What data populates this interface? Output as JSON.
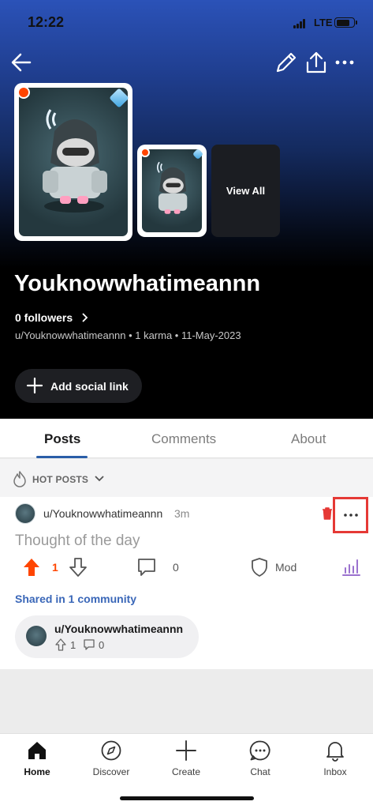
{
  "status": {
    "time": "12:22",
    "network": "LTE"
  },
  "header_icons": {
    "back": "back-arrow-icon",
    "edit": "pencil-icon",
    "share": "share-icon",
    "more": "more-horizontal-icon"
  },
  "profile": {
    "display_name": "Youknowwhatimeannn",
    "followers": "0 followers",
    "meta": "u/Youknowwhatimeannn • 1 karma • 11-May-2023",
    "view_all": "View All",
    "add_social": "Add social link"
  },
  "tabs": [
    {
      "label": "Posts",
      "active": true
    },
    {
      "label": "Comments"
    },
    {
      "label": "About"
    }
  ],
  "sort": {
    "label": "HOT POSTS"
  },
  "post": {
    "author": "u/Youknowwhatimeannn",
    "age": "3m",
    "title": "Thought of the day",
    "votes": "1",
    "comments": "0",
    "mod_label": "Mod",
    "shared": "Shared in 1 community",
    "crosspost": {
      "community": "u/Youknowwhatimeannn",
      "upvotes": "1",
      "comments": "0"
    }
  },
  "nav": [
    {
      "label": "Home",
      "icon": "home-icon",
      "active": true
    },
    {
      "label": "Discover",
      "icon": "compass-icon"
    },
    {
      "label": "Create",
      "icon": "plus-icon"
    },
    {
      "label": "Chat",
      "icon": "chat-icon"
    },
    {
      "label": "Inbox",
      "icon": "bell-icon"
    }
  ],
  "colors": {
    "upvote": "#ff4500",
    "accent": "#2a5ea8",
    "highlight_box": "#e53935"
  }
}
